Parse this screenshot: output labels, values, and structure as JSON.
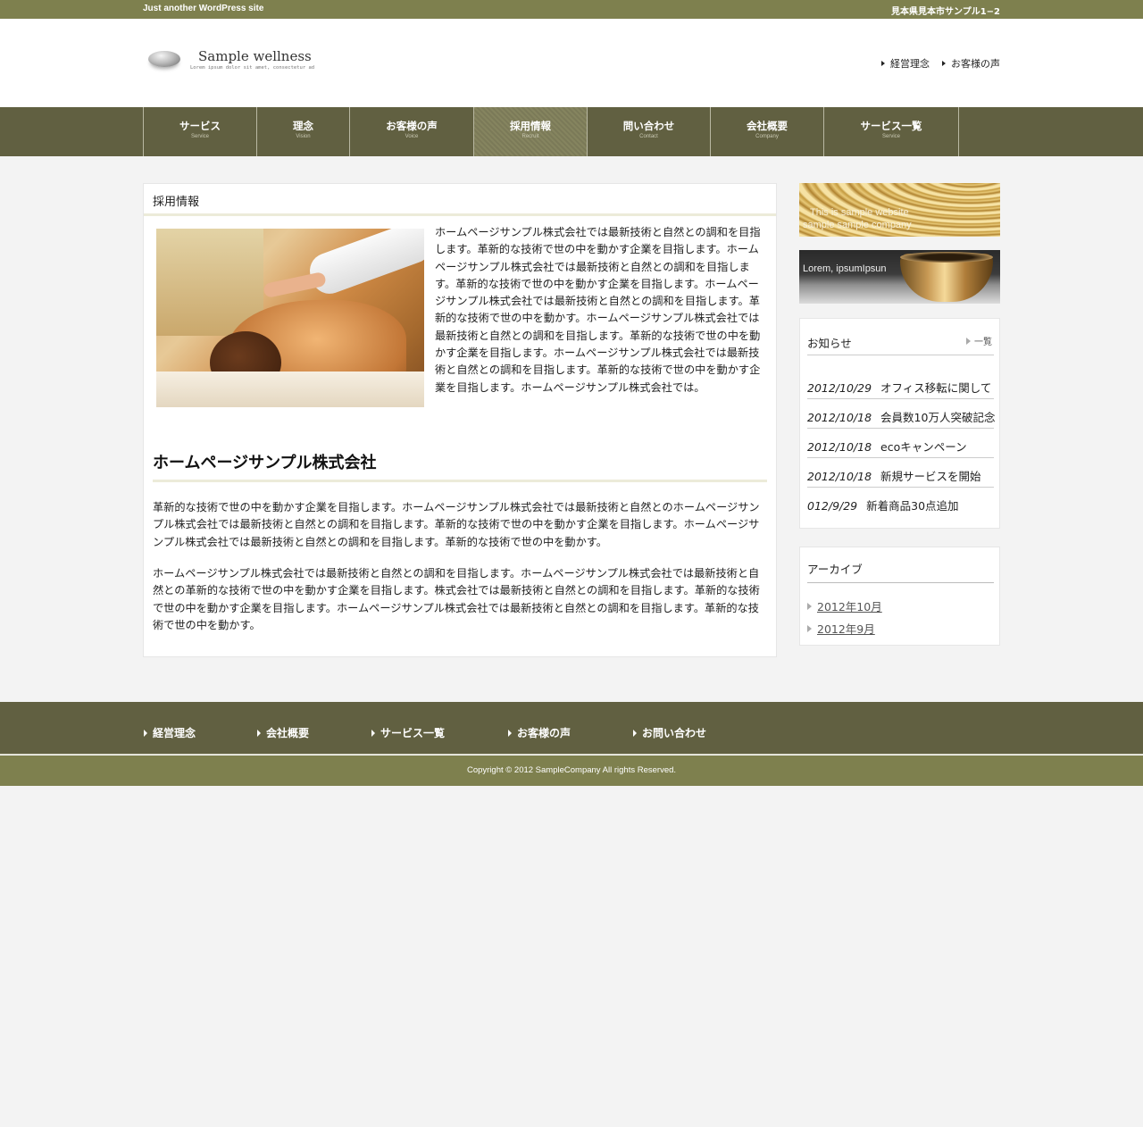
{
  "topbar": {
    "tagline": "Just another WordPress site",
    "address": "見本県見本市サンプル1−2"
  },
  "site": {
    "name": "Sample wellness",
    "subtitle": "Lorem ipsum dolor sit amet, consectetur ad"
  },
  "header_links": [
    {
      "label": "経営理念"
    },
    {
      "label": "お客様の声"
    }
  ],
  "nav": [
    {
      "jp": "サービス",
      "en": "Service"
    },
    {
      "jp": "理念",
      "en": "Vision"
    },
    {
      "jp": "お客様の声",
      "en": "Voice"
    },
    {
      "jp": "採用情報",
      "en": "Recruit",
      "active": true
    },
    {
      "jp": "問い合わせ",
      "en": "Contact"
    },
    {
      "jp": "会社概要",
      "en": "Company"
    },
    {
      "jp": "サービス一覧",
      "en": "Service"
    }
  ],
  "main": {
    "page_title": "採用情報",
    "intro": "ホームページサンプル株式会社では最新技術と自然との調和を目指します。革新的な技術で世の中を動かす企業を目指します。ホームページサンプル株式会社では最新技術と自然との調和を目指します。革新的な技術で世の中を動かす企業を目指します。ホームページサンプル株式会社では最新技術と自然との調和を目指します。革新的な技術で世の中を動かす。ホームページサンプル株式会社では最新技術と自然との調和を目指します。革新的な技術で世の中を動かす企業を目指します。ホームページサンプル株式会社では最新技術と自然との調和を目指します。革新的な技術で世の中を動かす企業を目指します。ホームページサンプル株式会社では。",
    "heading": "ホームページサンプル株式会社",
    "para1": "革新的な技術で世の中を動かす企業を目指します。ホームページサンプル株式会社では最新技術と自然とのホームページサンプル株式会社では最新技術と自然との調和を目指します。革新的な技術で世の中を動かす企業を目指します。ホームページサンプル株式会社では最新技術と自然との調和を目指します。革新的な技術で世の中を動かす。",
    "para2": "ホームページサンプル株式会社では最新技術と自然との調和を目指します。ホームページサンプル株式会社では最新技術と自然との革新的な技術で世の中を動かす企業を目指します。株式会社では最新技術と自然との調和を目指します。革新的な技術で世の中を動かす企業を目指します。ホームページサンプル株式会社では最新技術と自然との調和を目指します。革新的な技術で世の中を動かす。"
  },
  "banners": {
    "b1_line1": "This is sample website",
    "b1_line2": "sample sample company",
    "b2_text": "Lorem, ipsumIpsun"
  },
  "news": {
    "title": "お知らせ",
    "all_label": "一覧",
    "items": [
      {
        "date": "2012/10/29",
        "text": "オフィス移転に関して"
      },
      {
        "date": "2012/10/18",
        "text": "会員数10万人突破記念"
      },
      {
        "date": "2012/10/18",
        "text": "ecoキャンペーン"
      },
      {
        "date": "2012/10/18",
        "text": "新規サービスを開始"
      },
      {
        "date": "012/9/29",
        "text": "新着商品30点追加"
      }
    ]
  },
  "archive": {
    "title": "アーカイブ",
    "items": [
      {
        "label": "2012年10月"
      },
      {
        "label": "2012年9月"
      }
    ]
  },
  "footer": {
    "links": [
      {
        "label": "経営理念"
      },
      {
        "label": "会社概要"
      },
      {
        "label": "サービス一覧"
      },
      {
        "label": "お客様の声"
      },
      {
        "label": "お問い合わせ"
      }
    ],
    "copyright": "Copyright © 2012 SampleCompany All rights Reserved."
  },
  "colors": {
    "olive_light": "#7e804e",
    "olive_dark": "#616041",
    "accent_line": "#ecebd9",
    "background": "#f3f3f3"
  }
}
